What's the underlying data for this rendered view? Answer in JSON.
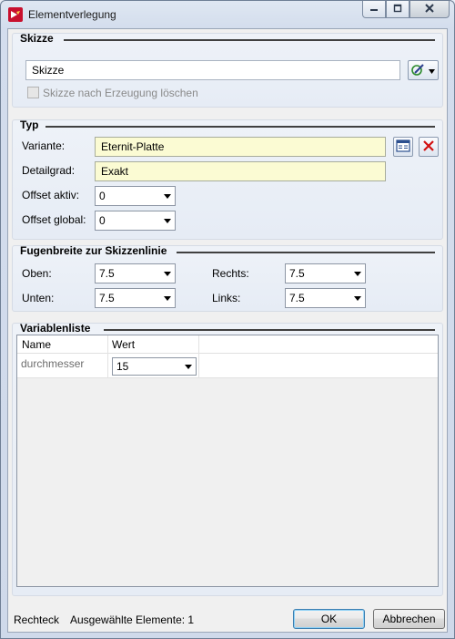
{
  "window": {
    "title": "Elementverlegung"
  },
  "skizze": {
    "group_title": "Skizze",
    "input_value": "Skizze",
    "delete_after_label": "Skizze nach Erzeugung löschen"
  },
  "typ": {
    "group_title": "Typ",
    "variante_label": "Variante:",
    "variante_value": "Eternit-Platte",
    "detailgrad_label": "Detailgrad:",
    "detailgrad_value": "Exakt",
    "offset_aktiv_label": "Offset aktiv:",
    "offset_aktiv_value": "0",
    "offset_global_label": "Offset global:",
    "offset_global_value": "0"
  },
  "fugen": {
    "group_title": "Fugenbreite zur Skizzenlinie",
    "oben_label": "Oben:",
    "oben_value": "7.5",
    "rechts_label": "Rechts:",
    "rechts_value": "7.5",
    "unten_label": "Unten:",
    "unten_value": "7.5",
    "links_label": "Links:",
    "links_value": "7.5"
  },
  "variablen": {
    "group_title": "Variablenliste",
    "columns": [
      "Name",
      "Wert"
    ],
    "rows": [
      {
        "name": "durchmesser",
        "wert": "15"
      }
    ]
  },
  "status": {
    "shape": "Rechteck",
    "selected": "Ausgewählte Elemente: 1"
  },
  "buttons": {
    "ok": "OK",
    "cancel": "Abbrechen"
  },
  "icons": [
    "app-icon",
    "minimize-icon",
    "maximize-icon",
    "close-icon",
    "sketch-tool-icon",
    "catalog-icon",
    "delete-x-icon",
    "chevron-down-icon"
  ]
}
